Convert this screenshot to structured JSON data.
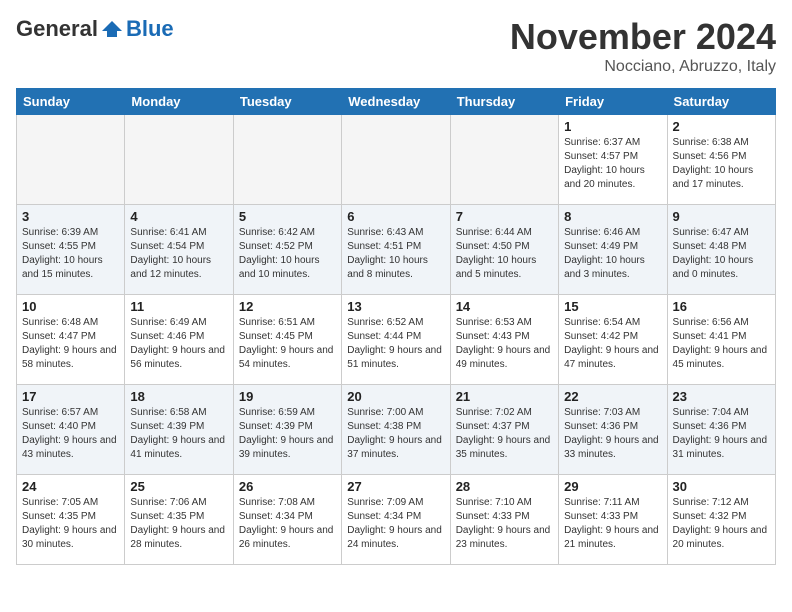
{
  "header": {
    "logo_general": "General",
    "logo_blue": "Blue",
    "month": "November 2024",
    "location": "Nocciano, Abruzzo, Italy"
  },
  "weekdays": [
    "Sunday",
    "Monday",
    "Tuesday",
    "Wednesday",
    "Thursday",
    "Friday",
    "Saturday"
  ],
  "weeks": [
    [
      {
        "day": "",
        "info": ""
      },
      {
        "day": "",
        "info": ""
      },
      {
        "day": "",
        "info": ""
      },
      {
        "day": "",
        "info": ""
      },
      {
        "day": "",
        "info": ""
      },
      {
        "day": "1",
        "info": "Sunrise: 6:37 AM\nSunset: 4:57 PM\nDaylight: 10 hours and 20 minutes."
      },
      {
        "day": "2",
        "info": "Sunrise: 6:38 AM\nSunset: 4:56 PM\nDaylight: 10 hours and 17 minutes."
      }
    ],
    [
      {
        "day": "3",
        "info": "Sunrise: 6:39 AM\nSunset: 4:55 PM\nDaylight: 10 hours and 15 minutes."
      },
      {
        "day": "4",
        "info": "Sunrise: 6:41 AM\nSunset: 4:54 PM\nDaylight: 10 hours and 12 minutes."
      },
      {
        "day": "5",
        "info": "Sunrise: 6:42 AM\nSunset: 4:52 PM\nDaylight: 10 hours and 10 minutes."
      },
      {
        "day": "6",
        "info": "Sunrise: 6:43 AM\nSunset: 4:51 PM\nDaylight: 10 hours and 8 minutes."
      },
      {
        "day": "7",
        "info": "Sunrise: 6:44 AM\nSunset: 4:50 PM\nDaylight: 10 hours and 5 minutes."
      },
      {
        "day": "8",
        "info": "Sunrise: 6:46 AM\nSunset: 4:49 PM\nDaylight: 10 hours and 3 minutes."
      },
      {
        "day": "9",
        "info": "Sunrise: 6:47 AM\nSunset: 4:48 PM\nDaylight: 10 hours and 0 minutes."
      }
    ],
    [
      {
        "day": "10",
        "info": "Sunrise: 6:48 AM\nSunset: 4:47 PM\nDaylight: 9 hours and 58 minutes."
      },
      {
        "day": "11",
        "info": "Sunrise: 6:49 AM\nSunset: 4:46 PM\nDaylight: 9 hours and 56 minutes."
      },
      {
        "day": "12",
        "info": "Sunrise: 6:51 AM\nSunset: 4:45 PM\nDaylight: 9 hours and 54 minutes."
      },
      {
        "day": "13",
        "info": "Sunrise: 6:52 AM\nSunset: 4:44 PM\nDaylight: 9 hours and 51 minutes."
      },
      {
        "day": "14",
        "info": "Sunrise: 6:53 AM\nSunset: 4:43 PM\nDaylight: 9 hours and 49 minutes."
      },
      {
        "day": "15",
        "info": "Sunrise: 6:54 AM\nSunset: 4:42 PM\nDaylight: 9 hours and 47 minutes."
      },
      {
        "day": "16",
        "info": "Sunrise: 6:56 AM\nSunset: 4:41 PM\nDaylight: 9 hours and 45 minutes."
      }
    ],
    [
      {
        "day": "17",
        "info": "Sunrise: 6:57 AM\nSunset: 4:40 PM\nDaylight: 9 hours and 43 minutes."
      },
      {
        "day": "18",
        "info": "Sunrise: 6:58 AM\nSunset: 4:39 PM\nDaylight: 9 hours and 41 minutes."
      },
      {
        "day": "19",
        "info": "Sunrise: 6:59 AM\nSunset: 4:39 PM\nDaylight: 9 hours and 39 minutes."
      },
      {
        "day": "20",
        "info": "Sunrise: 7:00 AM\nSunset: 4:38 PM\nDaylight: 9 hours and 37 minutes."
      },
      {
        "day": "21",
        "info": "Sunrise: 7:02 AM\nSunset: 4:37 PM\nDaylight: 9 hours and 35 minutes."
      },
      {
        "day": "22",
        "info": "Sunrise: 7:03 AM\nSunset: 4:36 PM\nDaylight: 9 hours and 33 minutes."
      },
      {
        "day": "23",
        "info": "Sunrise: 7:04 AM\nSunset: 4:36 PM\nDaylight: 9 hours and 31 minutes."
      }
    ],
    [
      {
        "day": "24",
        "info": "Sunrise: 7:05 AM\nSunset: 4:35 PM\nDaylight: 9 hours and 30 minutes."
      },
      {
        "day": "25",
        "info": "Sunrise: 7:06 AM\nSunset: 4:35 PM\nDaylight: 9 hours and 28 minutes."
      },
      {
        "day": "26",
        "info": "Sunrise: 7:08 AM\nSunset: 4:34 PM\nDaylight: 9 hours and 26 minutes."
      },
      {
        "day": "27",
        "info": "Sunrise: 7:09 AM\nSunset: 4:34 PM\nDaylight: 9 hours and 24 minutes."
      },
      {
        "day": "28",
        "info": "Sunrise: 7:10 AM\nSunset: 4:33 PM\nDaylight: 9 hours and 23 minutes."
      },
      {
        "day": "29",
        "info": "Sunrise: 7:11 AM\nSunset: 4:33 PM\nDaylight: 9 hours and 21 minutes."
      },
      {
        "day": "30",
        "info": "Sunrise: 7:12 AM\nSunset: 4:32 PM\nDaylight: 9 hours and 20 minutes."
      }
    ]
  ]
}
